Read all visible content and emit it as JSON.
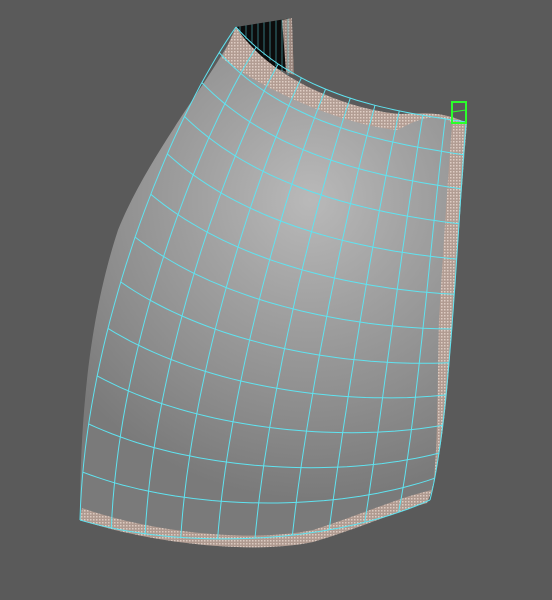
{
  "viewport": {
    "background": "#5a5a5a",
    "wire_color": "#5fe3f0",
    "dense_edge_color": "#c8b3a8",
    "selection_color": "#2bff2b",
    "backface_color": "#0b0b0b"
  },
  "mesh": {
    "object": "curved-shell-patch",
    "rows": 12,
    "cols": 10,
    "selected_face": "top-right-corner"
  }
}
